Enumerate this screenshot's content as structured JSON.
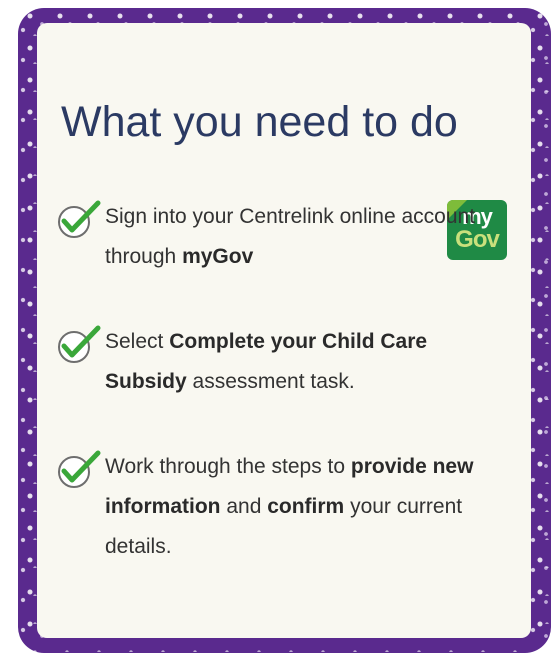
{
  "card": {
    "title": "What you need to do",
    "logo": {
      "my": "my",
      "gov": "Gov"
    },
    "steps": [
      [
        {
          "t": "Sign into your Centrelink online account through "
        },
        {
          "t": "myGov",
          "b": true
        }
      ],
      [
        {
          "t": "Select "
        },
        {
          "t": "Complete your Child Care Subsidy",
          "b": true
        },
        {
          "t": " assessment task."
        }
      ],
      [
        {
          "t": "Work through the steps to "
        },
        {
          "t": "provide new information",
          "b": true
        },
        {
          "t": " and "
        },
        {
          "t": "confirm",
          "b": true
        },
        {
          "t": " your current details."
        }
      ]
    ]
  },
  "colors": {
    "border": "#5a2a8e",
    "card": "#f9f8f1",
    "title": "#2b3a63",
    "check": "#3aa73a",
    "mygov_bg": "#1f8a45"
  }
}
